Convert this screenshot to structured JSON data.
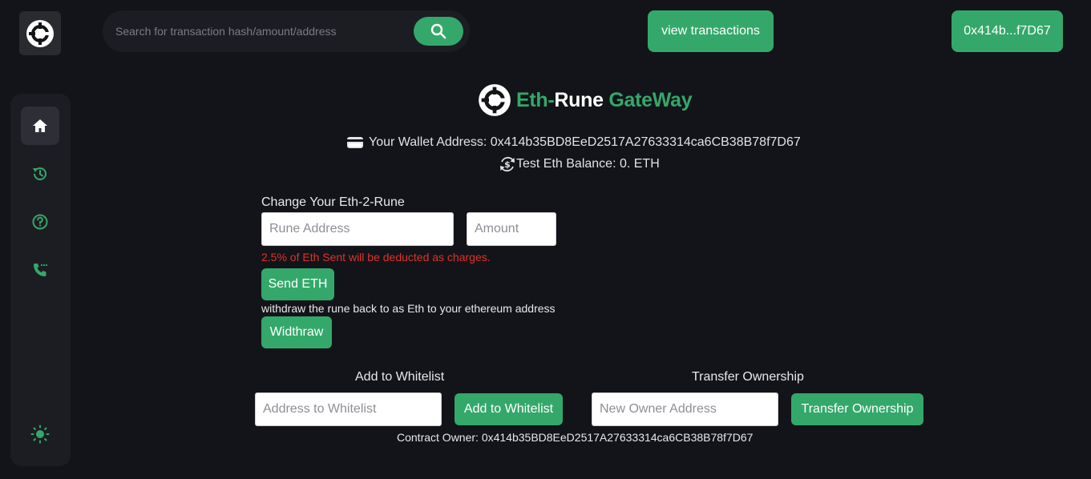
{
  "header": {
    "search_placeholder": "Search for transaction hash/amount/address",
    "view_transactions_label": "view transactions",
    "wallet_short": "0x414b...f7D67"
  },
  "sidebar": {
    "items": [
      {
        "icon": "home-icon",
        "active": true
      },
      {
        "icon": "history-icon",
        "active": false
      },
      {
        "icon": "help-icon",
        "active": false
      },
      {
        "icon": "phone-icon",
        "active": false
      }
    ],
    "theme_icon": "sun-icon"
  },
  "brand": {
    "part1": "Eth-",
    "part2": "Rune",
    "part3": "GateWay"
  },
  "wallet": {
    "label": "Your Wallet Address: 0x414b35BD8EeD2517A27633314ca6CB38B78f7D67",
    "balance": "Test Eth Balance: 0. ETH"
  },
  "exchange": {
    "heading": "Change Your Eth-2-Rune",
    "rune_placeholder": "Rune Address",
    "amount_placeholder": "Amount",
    "charges_note": "2.5% of Eth Sent will be deducted as charges.",
    "send_label": "Send ETH",
    "withdraw_note": "withdraw the rune back to as Eth to your ethereum address",
    "withdraw_label": "Widthraw"
  },
  "whitelist": {
    "heading": "Add to Whitelist",
    "placeholder": "Address to Whitelist",
    "button_label": "Add to Whitelist"
  },
  "ownership": {
    "heading": "Transfer Ownership",
    "placeholder": "New Owner Address",
    "button_label": "Transfer Ownership"
  },
  "contract_owner": "Contract Owner: 0x414b35BD8EeD2517A27633314ca6CB38B78f7D67",
  "colors": {
    "accent": "#34a86a",
    "background": "#131419",
    "panel": "#1c1d23",
    "warning": "#e0312b"
  }
}
